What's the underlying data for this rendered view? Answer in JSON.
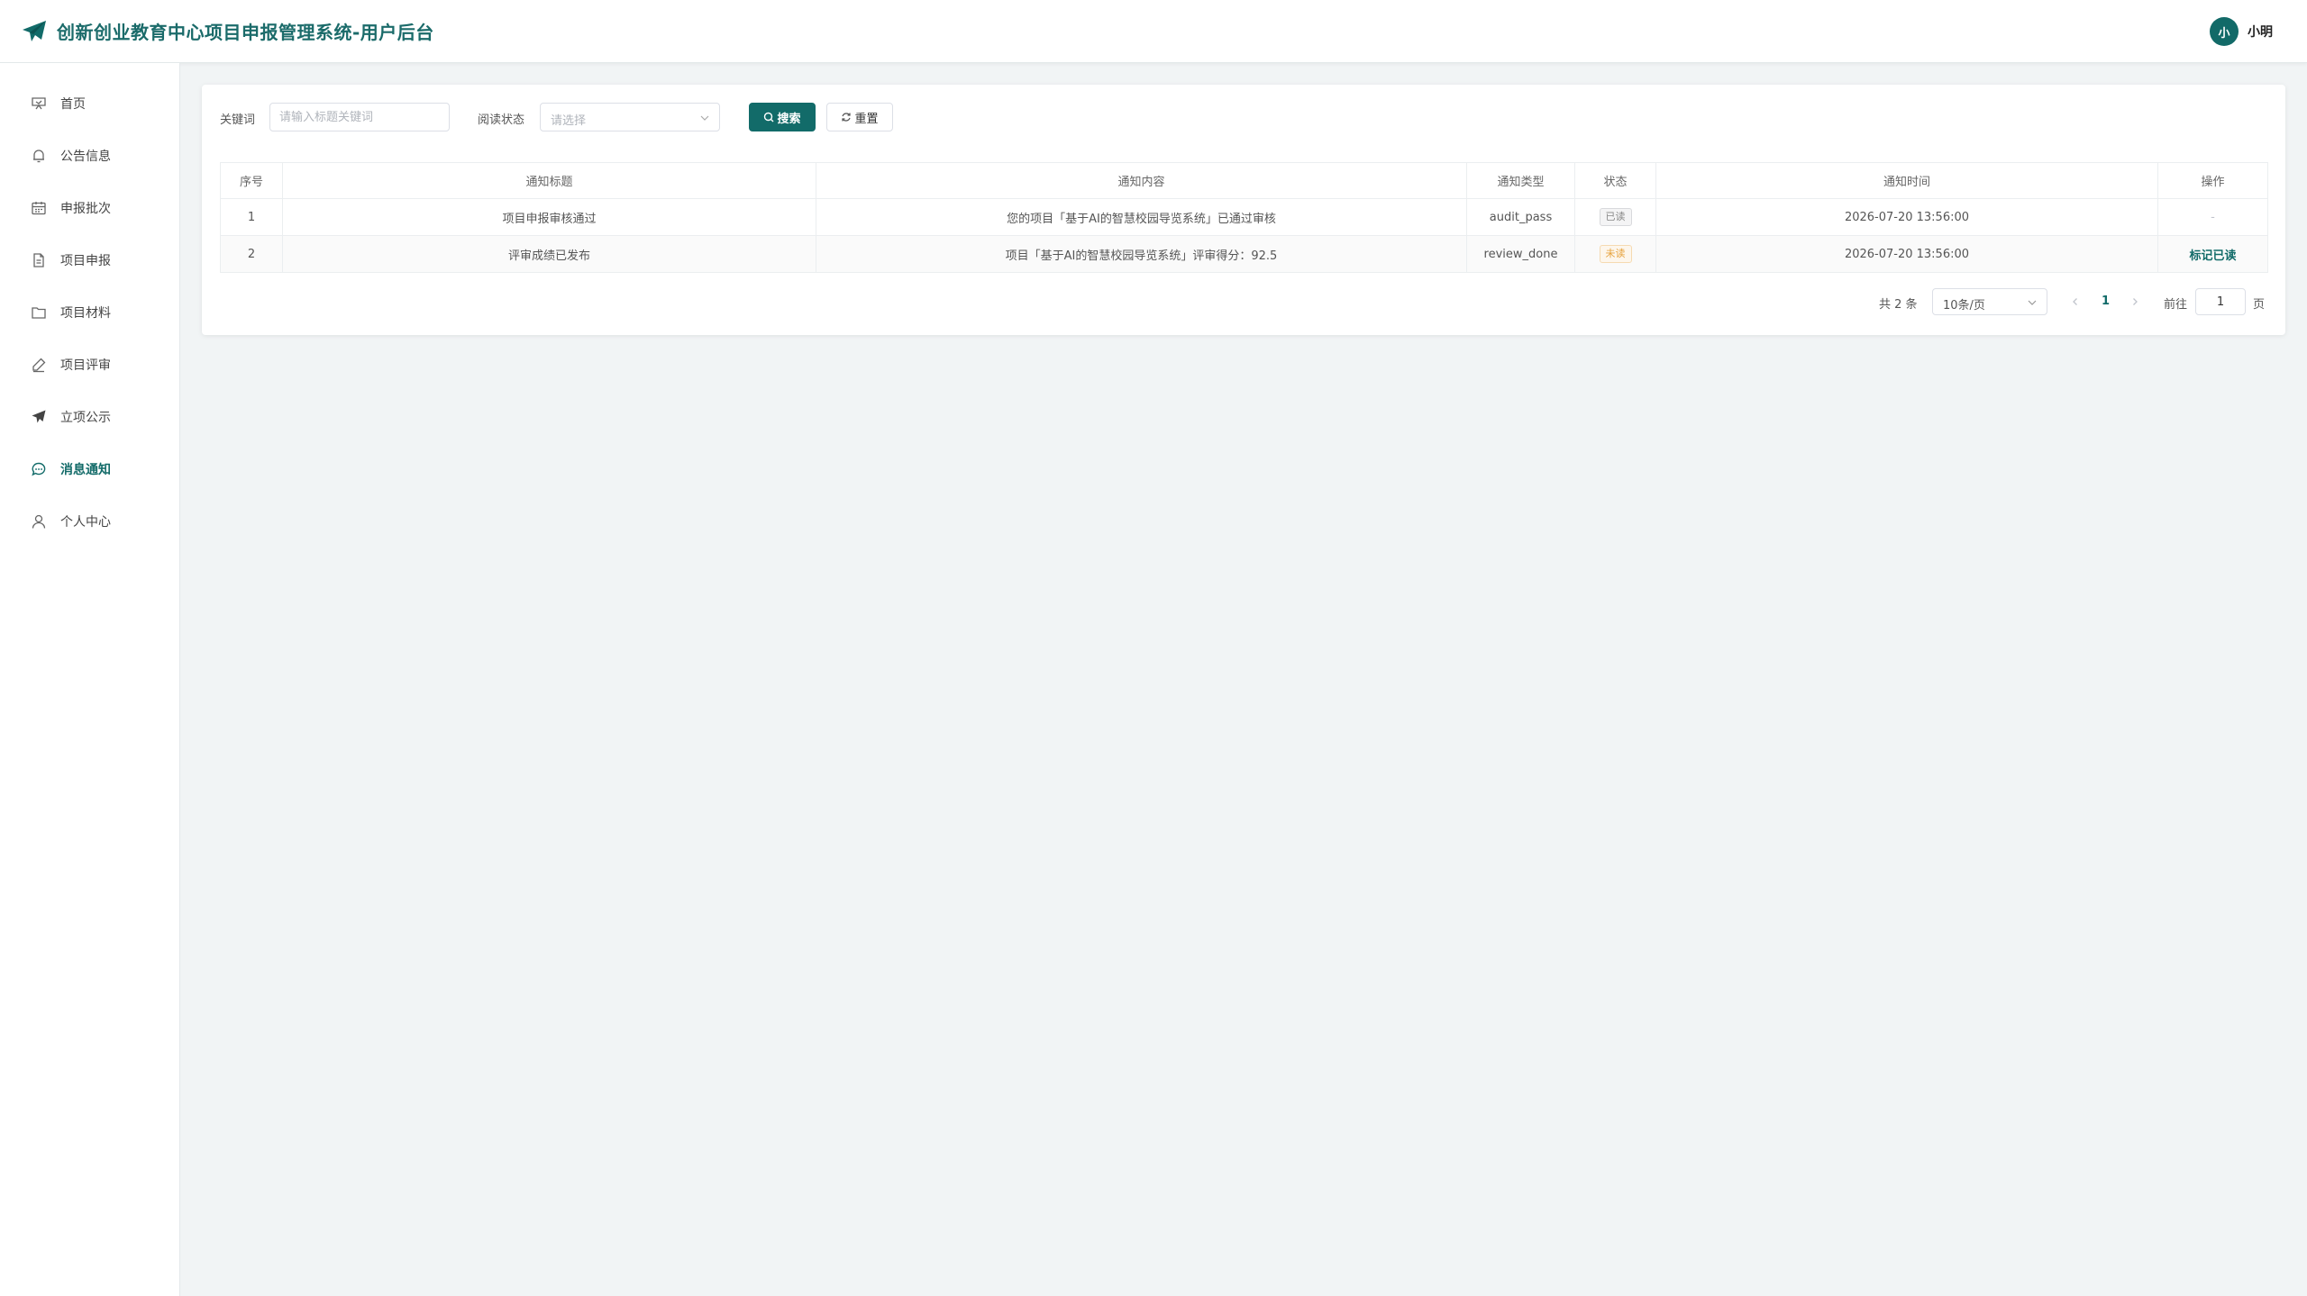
{
  "header": {
    "title": "创新创业教育中心项目申报管理系统-用户后台",
    "avatar_text": "小",
    "username": "小明",
    "logo_icon": "paper-plane-icon",
    "accent_color": "#126b69"
  },
  "sidebar": {
    "items": [
      {
        "label": "首页",
        "icon": "home-icon"
      },
      {
        "label": "公告信息",
        "icon": "bell-icon"
      },
      {
        "label": "申报批次",
        "icon": "calendar-icon"
      },
      {
        "label": "项目申报",
        "icon": "document-icon"
      },
      {
        "label": "项目材料",
        "icon": "folder-icon"
      },
      {
        "label": "项目评审",
        "icon": "pen-icon"
      },
      {
        "label": "立项公示",
        "icon": "send-icon"
      },
      {
        "label": "消息通知",
        "icon": "message-icon",
        "active": true
      },
      {
        "label": "个人中心",
        "icon": "user-icon"
      }
    ]
  },
  "filters": {
    "keyword_label": "关键词",
    "keyword_placeholder": "请输入标题关键词",
    "read_status_label": "阅读状态",
    "read_status_placeholder": "请选择",
    "search_button": "搜索",
    "reset_button": "重置"
  },
  "table": {
    "columns": [
      "序号",
      "通知标题",
      "通知内容",
      "通知类型",
      "状态",
      "通知时间",
      "操作"
    ],
    "rows": [
      {
        "index": "1",
        "title": "项目申报审核通过",
        "content": "您的项目「基于AI的智慧校园导览系统」已通过审核",
        "type": "audit_pass",
        "status": "已读",
        "time": "2026-07-20 13:56:00",
        "action": "-"
      },
      {
        "index": "2",
        "title": "评审成绩已发布",
        "content": "项目「基于AI的智慧校园导览系统」评审得分：92.5",
        "type": "review_done",
        "status": "未读",
        "time": "2026-07-20 13:56:00",
        "action": "标记已读"
      }
    ]
  },
  "pagination": {
    "total_text": "共 2 条",
    "page_size": "10条/页",
    "current_page": "1",
    "goto_label": "前往",
    "goto_value": "1",
    "page_suffix": "页"
  }
}
